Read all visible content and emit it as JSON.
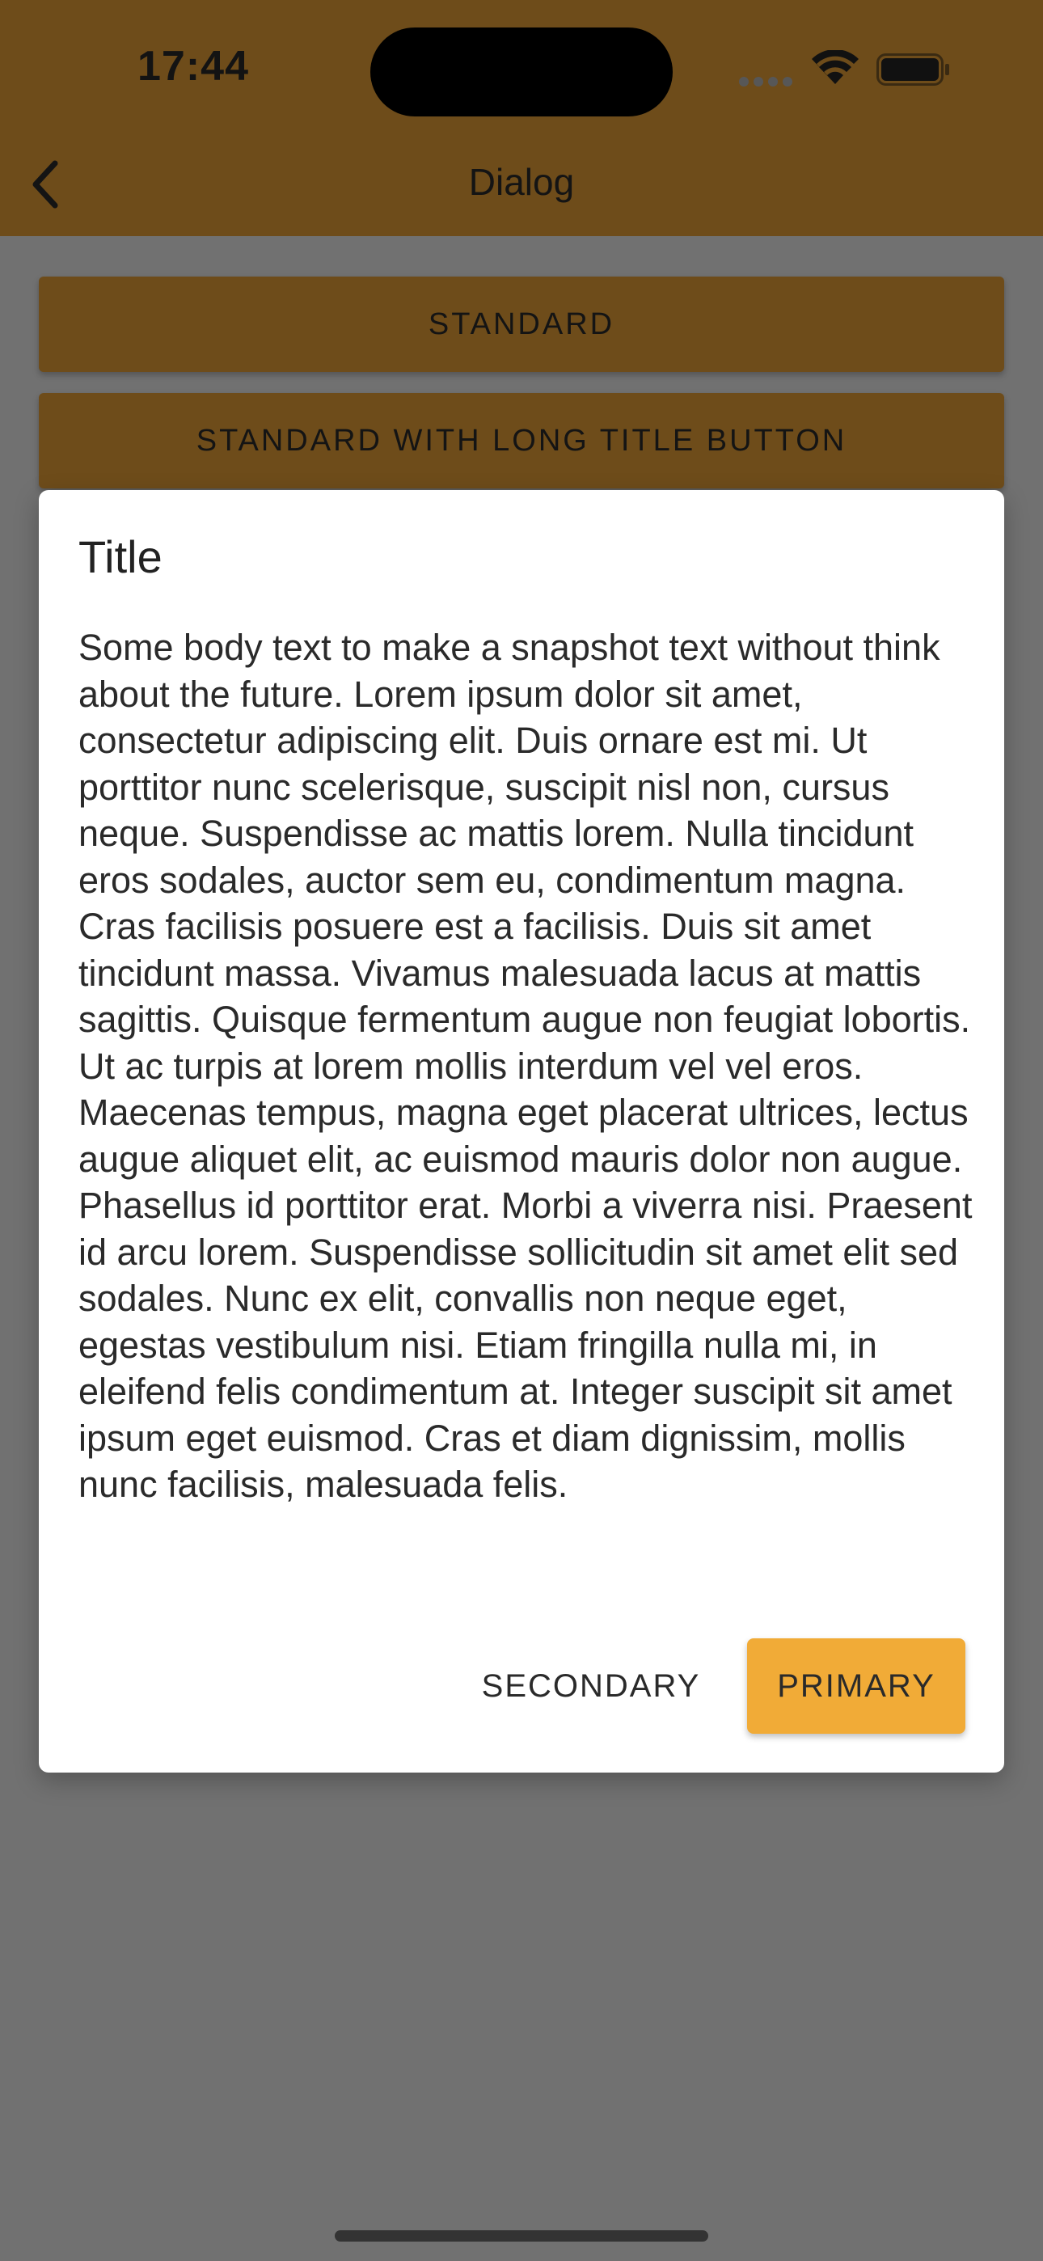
{
  "status_bar": {
    "time": "17:44"
  },
  "nav": {
    "title": "Dialog",
    "back_icon": "chevron-left-icon"
  },
  "buttons": {
    "standard": "STANDARD",
    "standard_long": "STANDARD WITH LONG TITLE BUTTON"
  },
  "dialog": {
    "title": "Title",
    "body": "Some body text to make a snapshot text without think about the future. Lorem ipsum dolor sit amet, consectetur adipiscing elit. Duis ornare est mi. Ut porttitor nunc scelerisque, suscipit nisl non, cursus neque. Suspendisse ac mattis lorem. Nulla tincidunt eros sodales, auctor sem eu, condimentum magna. Cras facilisis posuere est a facilisis. Duis sit amet tincidunt massa. Vivamus malesuada lacus at mattis sagittis. Quisque fermentum augue non feugiat lobortis. Ut ac turpis at lorem mollis interdum vel vel eros. Maecenas tempus, magna eget placerat ultrices, lectus augue aliquet elit, ac euismod mauris dolor non augue. Phasellus id porttitor erat. Morbi a viverra nisi. Praesent id arcu lorem. Suspendisse sollicitudin sit amet elit sed sodales. Nunc ex elit, convallis non neque eget, egestas vestibulum nisi. Etiam fringilla nulla mi, in eleifend felis condimentum at. Integer suscipit sit amet ipsum eget euismod. Cras et diam dignissim, mollis nunc facilisis, malesuada felis.",
    "secondary_label": "SECONDARY",
    "primary_label": "PRIMARY"
  },
  "colors": {
    "accent": "#f1ab37",
    "header_dimmed": "#6e4c1a",
    "overlay_background": "#717171",
    "dialog_background": "#ffffff"
  }
}
